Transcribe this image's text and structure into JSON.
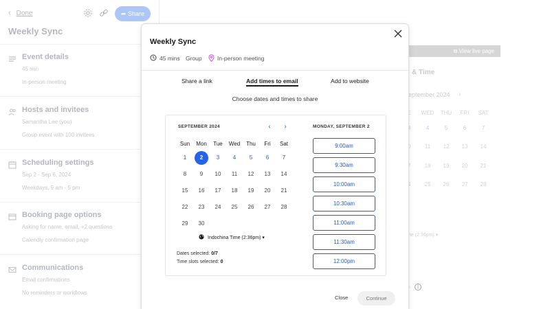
{
  "left_panel": {
    "done_label": "Done",
    "share_label": "Share",
    "title": "Weekly Sync",
    "sections": [
      {
        "title": "Event details",
        "icon": "lines-icon",
        "lines": [
          "45 min",
          "In-person meeting"
        ]
      },
      {
        "title": "Hosts and invitees",
        "icon": "people-icon",
        "lines": [
          "Samantha Lee (you)",
          "Group event with 100 invitees"
        ]
      },
      {
        "title": "Scheduling settings",
        "icon": "calendar-icon",
        "lines": [
          "Sep 2 - Sep 6, 2024",
          "Weekdays, 9 am - 5 pm"
        ]
      },
      {
        "title": "Booking page options",
        "icon": "browser-icon",
        "lines": [
          "Asking for name, email, +2 questions",
          "Calendly confirmation page"
        ]
      },
      {
        "title": "Communications",
        "icon": "mail-icon",
        "lines": [
          "Email confirmations",
          "No reminders or workflows"
        ]
      }
    ]
  },
  "background_right": {
    "view_live_label": "View live page",
    "heading": "& Time",
    "month": "eptember 2024",
    "calendar_header": [
      "E",
      "WED",
      "THU",
      "FRI",
      "SAT"
    ],
    "calendar_rows": [
      [
        "3",
        "4",
        "5",
        "6",
        "7"
      ],
      [
        "0",
        "11",
        "12",
        "13",
        "14"
      ],
      [
        "7",
        "18",
        "19",
        "20",
        "21"
      ],
      [
        "4",
        "25",
        "26",
        "27",
        "28"
      ]
    ],
    "timezone": "ne (2:36pm) ▾"
  },
  "modal": {
    "title": "Weekly Sync",
    "duration": "45 mins",
    "event_type": "Group",
    "location": "In-person meeting",
    "tabs": [
      "Share a link",
      "Add times to email",
      "Add to website"
    ],
    "active_tab": "Add times to email",
    "instruction": "Choose dates and times to share",
    "calendar": {
      "month_label": "SEPTEMBER 2024",
      "days_of_week": [
        "Sun",
        "Mon",
        "Tue",
        "Wed",
        "Thu",
        "Fri",
        "Sat"
      ],
      "weeks": [
        [
          "1",
          "2",
          "3",
          "4",
          "5",
          "6",
          "7"
        ],
        [
          "8",
          "9",
          "10",
          "11",
          "12",
          "13",
          "14"
        ],
        [
          "15",
          "16",
          "17",
          "18",
          "19",
          "20",
          "21"
        ],
        [
          "22",
          "23",
          "24",
          "25",
          "26",
          "27",
          "28"
        ],
        [
          "29",
          "30",
          "",
          "",
          "",
          "",
          ""
        ]
      ],
      "selected_day": "2",
      "available_days": [
        "3",
        "4",
        "5",
        "6"
      ],
      "timezone": "Indochina Time (2:36pm) ▾",
      "dates_selected_label": "Dates selected:",
      "dates_selected_value": "0/7",
      "slots_selected_label": "Time slots selected:",
      "slots_selected_value": "0"
    },
    "day_label": "MONDAY, SEPTEMBER 2",
    "time_slots": [
      "9:00am",
      "9:30am",
      "10:00am",
      "10:30am",
      "11:00am",
      "11:30am",
      "12:00pm"
    ],
    "close_label": "Close",
    "continue_label": "Continue"
  },
  "colors": {
    "accent": "#2563eb",
    "slot_border": "#2d59c9",
    "share_button": "#8fb3f5"
  }
}
